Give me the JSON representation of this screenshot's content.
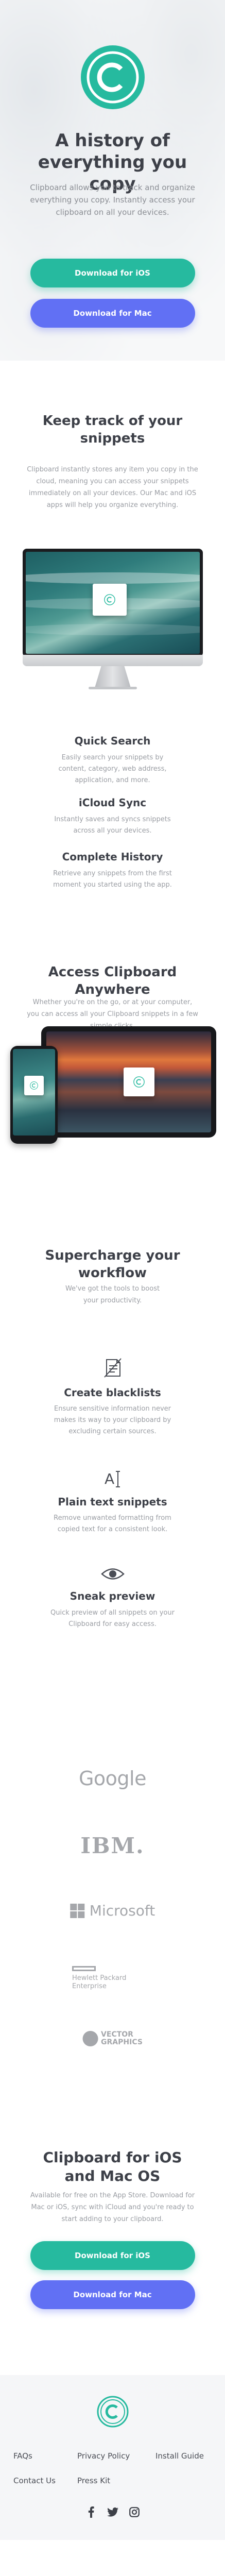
{
  "colors": {
    "brand_green": "#26ba9f",
    "brand_blue": "#6170f4",
    "heading": "#3d4048",
    "body_text": "#9a9da3",
    "logo_gray": "#a5a7ab",
    "footer_bg": "#f5f6f8"
  },
  "hero": {
    "logo_icon": "clipboard-c-logo-icon",
    "title": "A history of everything you copy",
    "description": "Clipboard allows you to track and organize everything you copy. Instantly access your clipboard on all your devices.",
    "ios_button": "Download for iOS",
    "mac_button": "Download for Mac"
  },
  "snippets": {
    "title": "Keep track of your snippets",
    "description": "Clipboard instantly stores any item you copy in the cloud, meaning you can access your snippets immediately on all your devices. Our Mac and iOS apps will help you organize everything.",
    "features": [
      {
        "title": "Quick Search",
        "description": "Easily search your snippets by content, category, web address, application, and more."
      },
      {
        "title": "iCloud Sync",
        "description": "Instantly saves and syncs snippets across all your devices."
      },
      {
        "title": "Complete History",
        "description": "Retrieve any snippets from the first moment you started using the app."
      }
    ]
  },
  "access": {
    "title": "Access Clipboard Anywhere",
    "description": "Whether you're on the go, or at your computer, you can access all your Clipboard snippets in a few simple clicks."
  },
  "supercharge": {
    "title": "Supercharge your workflow",
    "description": "We've got the tools to boost your productivity.",
    "features": [
      {
        "icon": "blacklist-icon",
        "title": "Create blacklists",
        "description": "Ensure sensitive information never makes its way to your clipboard by excluding certain sources."
      },
      {
        "icon": "text-cursor-icon",
        "title": "Plain text snippets",
        "description": "Remove unwanted formatting from copied text for a consistent look."
      },
      {
        "icon": "eye-icon",
        "title": "Sneak preview",
        "description": "Quick preview of all snippets on your Clipboard for easy access."
      }
    ]
  },
  "logos": {
    "google": "Google",
    "ibm": "IBM.",
    "microsoft": "Microsoft",
    "hpe_line1": "Hewlett Packard",
    "hpe_line2": "Enterprise",
    "vg_line1": "VECTOR",
    "vg_line2": "GRAPHICS"
  },
  "cta": {
    "title": "Clipboard for iOS and Mac OS",
    "description": "Available for free on the App Store. Download for Mac or iOS, sync with iCloud and you're ready to start adding to your clipboard.",
    "ios_button": "Download for iOS",
    "mac_button": "Download for Mac"
  },
  "footer": {
    "links": [
      "FAQs",
      "Privacy Policy",
      "Install Guide",
      "Contact Us",
      "Press Kit"
    ],
    "socials": [
      "facebook-icon",
      "twitter-icon",
      "instagram-icon"
    ]
  }
}
